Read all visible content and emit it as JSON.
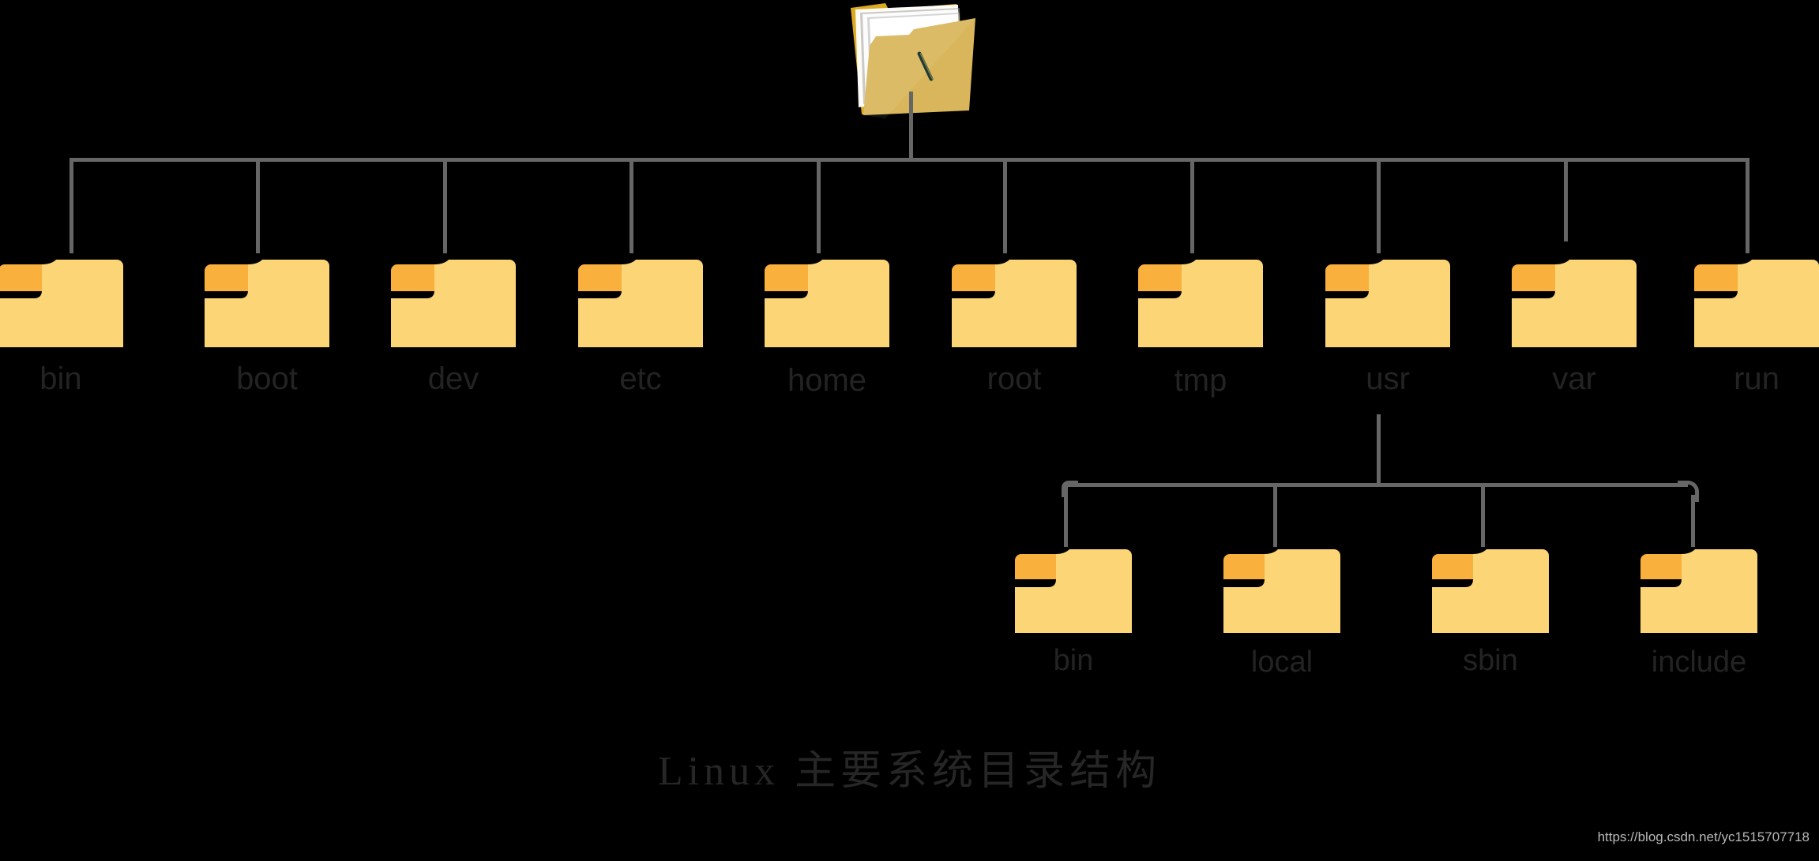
{
  "diagram": {
    "caption": "Linux  主要系统目录结构",
    "watermark": "https://blog.csdn.net/yc1515707718",
    "colors": {
      "background": "#000000",
      "folder_body": "#FCD577",
      "folder_tab": "#FAB03C",
      "folder_root_back": "#DBAA23",
      "folder_root_front": "#D9B65B",
      "folder_paper": "#F5F5F5",
      "connector": "#666666",
      "label_text": "#232323",
      "caption_text": "#262626",
      "watermark_text": "#b9b9b9",
      "root_slash": "#1C3B38"
    },
    "root": {
      "name": "root-directory",
      "icon": "open-folder-with-papers-icon",
      "marker": "/"
    },
    "level1": [
      {
        "label": "bin",
        "icon": "folder-icon"
      },
      {
        "label": "boot",
        "icon": "folder-icon"
      },
      {
        "label": "dev",
        "icon": "folder-icon"
      },
      {
        "label": "etc",
        "icon": "folder-icon"
      },
      {
        "label": "home",
        "icon": "folder-icon"
      },
      {
        "label": "root",
        "icon": "folder-icon"
      },
      {
        "label": "tmp",
        "icon": "folder-icon"
      },
      {
        "label": "usr",
        "icon": "folder-icon"
      },
      {
        "label": "var",
        "icon": "folder-icon"
      },
      {
        "label": "run",
        "icon": "folder-icon"
      }
    ],
    "level2_parent": "usr",
    "level2": [
      {
        "label": "bin",
        "icon": "folder-icon"
      },
      {
        "label": "local",
        "icon": "folder-icon"
      },
      {
        "label": "sbin",
        "icon": "folder-icon"
      },
      {
        "label": "include",
        "icon": "folder-icon"
      }
    ]
  }
}
